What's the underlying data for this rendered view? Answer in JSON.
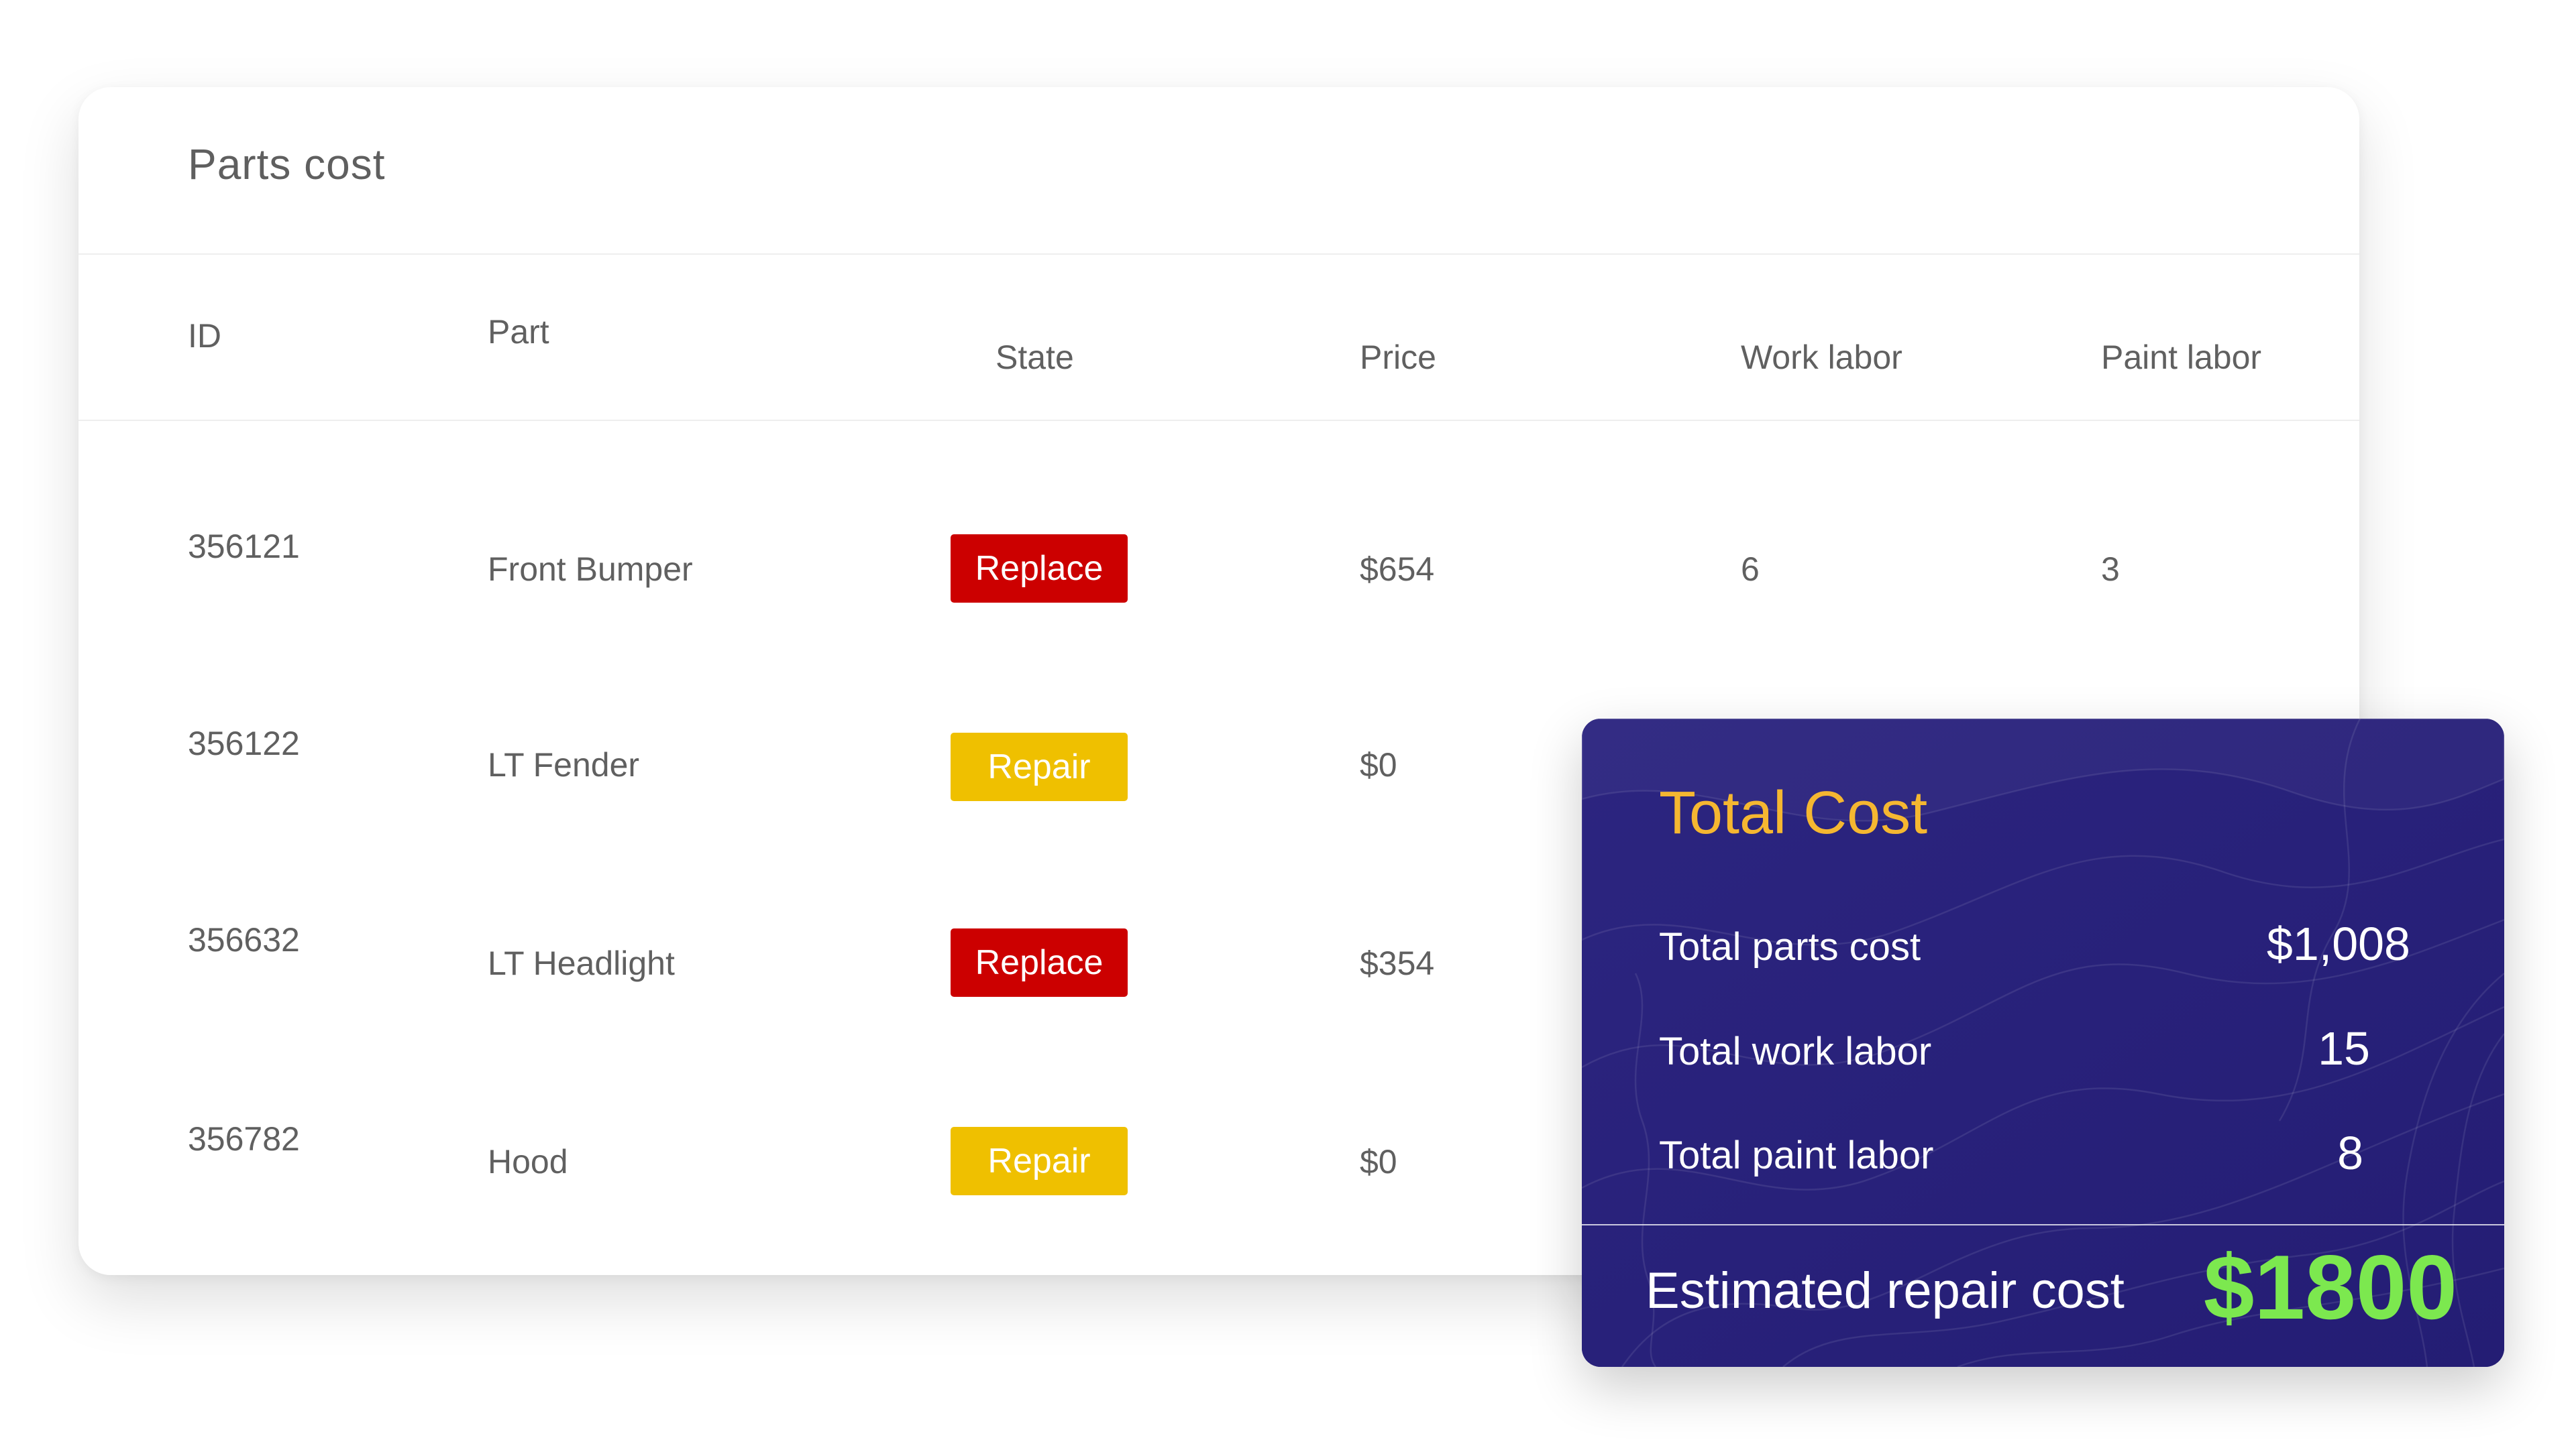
{
  "parts_table": {
    "title": "Parts cost",
    "columns": {
      "id": "ID",
      "part": "Part",
      "state": "State",
      "price": "Price",
      "work_labor": "Work labor",
      "paint_labor": "Paint labor"
    },
    "rows": [
      {
        "id": "356121",
        "part": "Front Bumper",
        "state": "Replace",
        "price": "$654",
        "work_labor": "6",
        "paint_labor": "3"
      },
      {
        "id": "356122",
        "part": "LT Fender",
        "state": "Repair",
        "price": "$0",
        "work_labor": "",
        "paint_labor": ""
      },
      {
        "id": "356632",
        "part": "LT Headlight",
        "state": "Replace",
        "price": "$354",
        "work_labor": "",
        "paint_labor": ""
      },
      {
        "id": "356782",
        "part": "Hood",
        "state": "Repair",
        "price": "$0",
        "work_labor": "",
        "paint_labor": ""
      }
    ]
  },
  "total_cost": {
    "title": "Total Cost",
    "parts_label": "Total parts cost",
    "parts_value": "$1,008",
    "work_label": "Total work labor",
    "work_value": "15",
    "paint_label": "Total paint labor",
    "paint_value": "8",
    "estimate_label": "Estimated repair cost",
    "estimate_value": "$1800"
  },
  "colors": {
    "replace_badge": "#cc0000",
    "repair_badge": "#efc000",
    "card_background": "#272079",
    "title_accent": "#f5b731",
    "estimate_accent": "#7ce84f"
  }
}
